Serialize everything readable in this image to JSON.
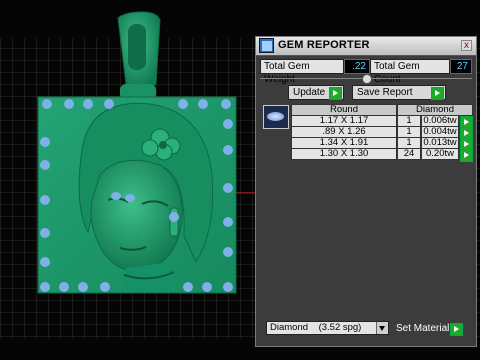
{
  "panel": {
    "title": "GEM REPORTER",
    "close_label": "x",
    "total_weight_label": "Total Gem Weight",
    "total_weight_value": ".22",
    "total_count_label": "Total Gem Count",
    "total_count_value": "27",
    "update_label": "Update",
    "save_report_label": "Save Report",
    "table": {
      "columns": [
        "Round",
        "Diamond"
      ],
      "rows": [
        {
          "size": "1.17 X 1.17",
          "count": "1",
          "weight": "0.006tw"
        },
        {
          "size": ".89 X 1.26",
          "count": "1",
          "weight": "0.004tw"
        },
        {
          "size": "1.34 X 1.91",
          "count": "1",
          "weight": "0.013tw"
        },
        {
          "size": "1.30 X 1.30",
          "count": "24",
          "weight": "0.20tw"
        }
      ]
    },
    "material_selected": "Diamond    (3.52 spg)",
    "set_material_label": "Set Material"
  },
  "colors": {
    "model_green": "#1f9e6c",
    "gem_blue": "#7fb0ea",
    "value_cyan": "#5fd4ff",
    "go_green": "#1faa2c"
  },
  "icons": [
    "gem-reporter-app-icon",
    "close-icon",
    "go-arrow-icon",
    "gem-thumbnail-icon",
    "dropdown-arrow-icon"
  ]
}
